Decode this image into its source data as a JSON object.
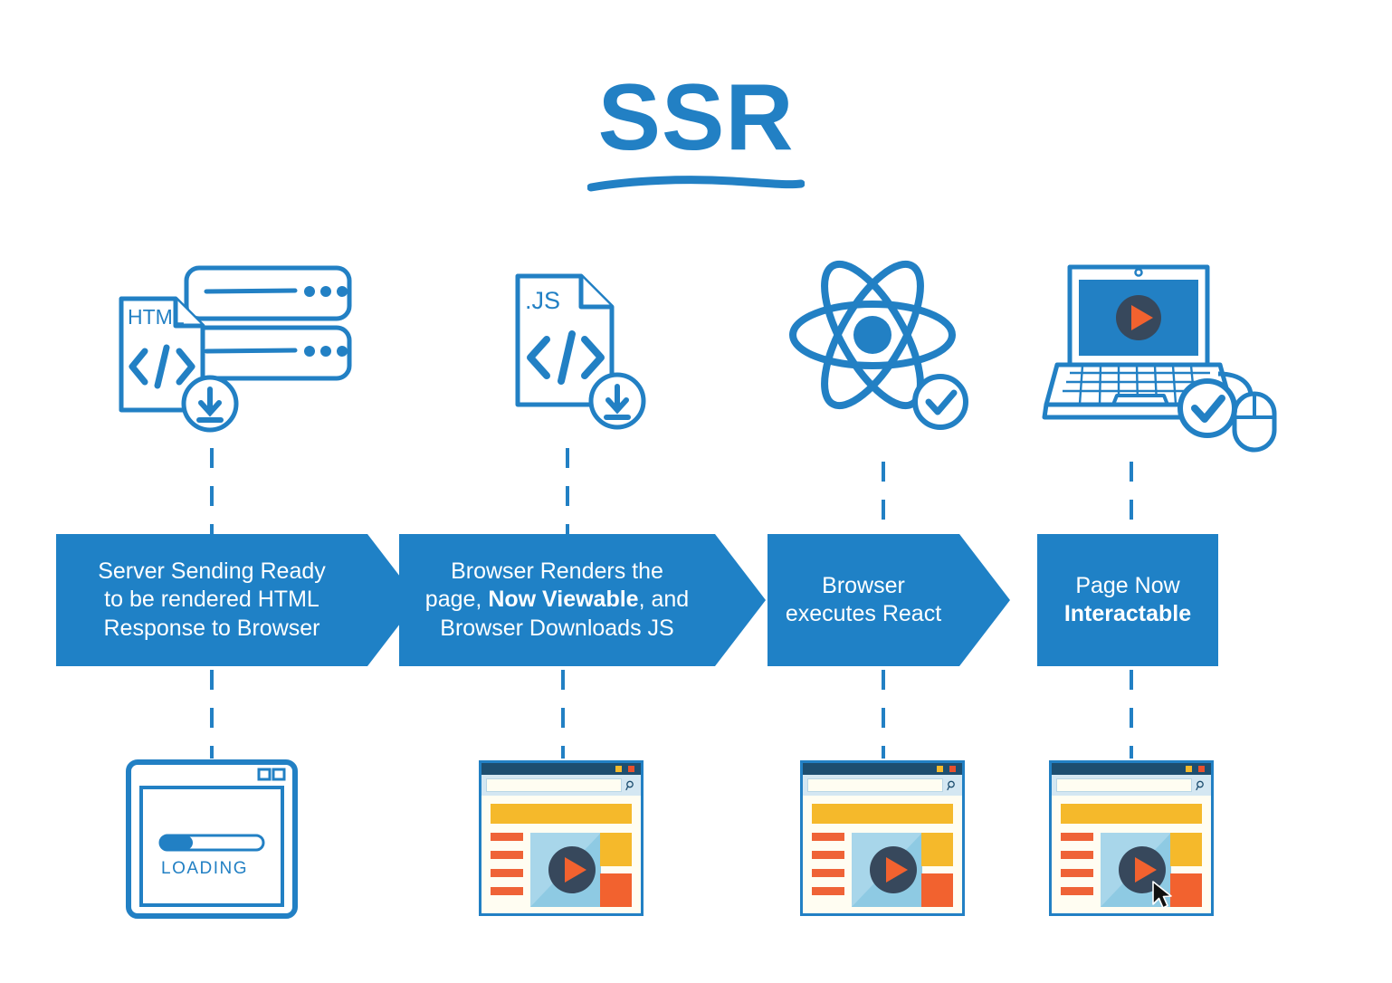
{
  "page": {
    "title": "SSR",
    "background_color": "#ffffff",
    "accent_color": "#2280c4",
    "banner_color": "#1f81c6"
  },
  "steps": [
    {
      "id": "step-1",
      "top_icon_name": "html-server-download-icon",
      "top_icon_labels": {
        "file_label": "HTML",
        "code_symbol": "</>"
      },
      "banner": {
        "line1": "Server Sending Ready",
        "line2": "to be rendered HTML",
        "line3": "Response to Browser",
        "has_arrow": true
      },
      "mockup": {
        "kind": "loading-browser",
        "loading_label": "LOADING",
        "progress_percent": 30
      }
    },
    {
      "id": "step-2",
      "top_icon_name": "js-file-download-icon",
      "top_icon_labels": {
        "file_label": ".JS",
        "code_symbol": "</>"
      },
      "banner": {
        "line1": "Browser Renders the",
        "line2_pre": "page, ",
        "line2_bold": "Now Viewable",
        "line2_post": ", and",
        "line3": "Browser Downloads JS",
        "has_arrow": true
      },
      "mockup": {
        "kind": "rendered-page",
        "has_cursor": false
      }
    },
    {
      "id": "step-3",
      "top_icon_name": "react-atom-check-icon",
      "top_icon_labels": {},
      "banner": {
        "line1": "Browser",
        "line2": "executes React",
        "has_arrow": true
      },
      "mockup": {
        "kind": "rendered-page",
        "has_cursor": false
      }
    },
    {
      "id": "step-4",
      "top_icon_name": "laptop-mouse-check-icon",
      "top_icon_labels": {},
      "banner": {
        "line1": "Page Now",
        "line2_bold": "Interactable",
        "has_arrow": false
      },
      "mockup": {
        "kind": "rendered-page",
        "has_cursor": true
      }
    }
  ],
  "mockup_colors": {
    "titlebar": "#1d4e70",
    "urlbar_strip": "#d4e7f2",
    "page_background": "#fffdf2",
    "banner_bar": "#f5b92b",
    "sidebar_bar": "#ef6337",
    "video_panel": "#8ecae3",
    "play_circle": "#37485c",
    "play_triangle": "#f2622f",
    "box_yellow": "#f5b92b",
    "box_orange": "#f2622f",
    "window_dot_yellow": "#f5b92b",
    "window_dot_red": "#e8502e"
  }
}
